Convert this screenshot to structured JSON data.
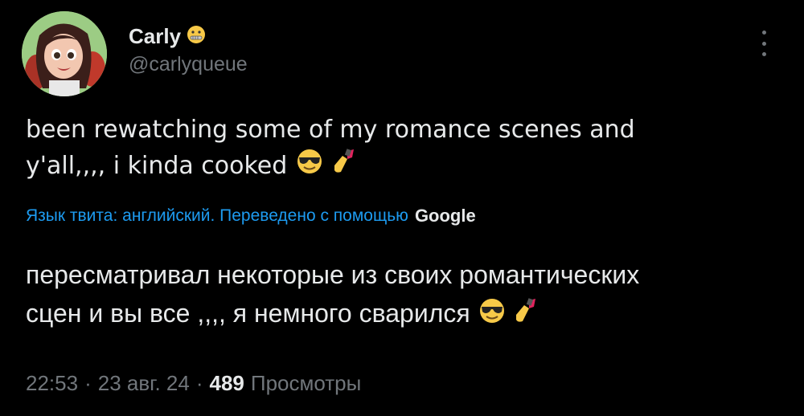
{
  "author": {
    "display_name": "Carly",
    "handle": "@carlyqueue",
    "name_emoji": "zipper-mouth-face-icon"
  },
  "tweet": {
    "text_line1": "been rewatching some of my romance scenes and",
    "text_line2": "y'all,,,, i kinda cooked",
    "emojis": [
      "sunglasses-face-icon",
      "nail-polish-icon"
    ]
  },
  "translation": {
    "note": "Язык твита: английский. Переведено с помощью",
    "provider": "Google",
    "text_line1": "пересматривал некоторые из своих романтических",
    "text_line2": "сцен и вы все ,,,, я немного сварился"
  },
  "meta": {
    "time": "22:53",
    "sep1": "·",
    "date": "23 авг. 24",
    "sep2": "·",
    "views_count": "489",
    "views_label": "Просмотры"
  },
  "colors": {
    "background": "#000000",
    "text": "#e7e9ea",
    "secondary": "#71767b",
    "link": "#1d9bf0"
  }
}
